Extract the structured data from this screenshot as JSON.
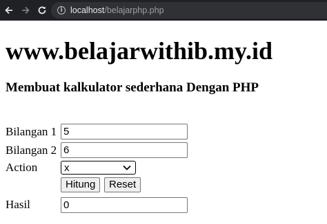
{
  "browser": {
    "url_host": "localhost",
    "url_path": "/belajarphp.php",
    "back_icon": "arrow-left-icon",
    "forward_icon": "arrow-right-icon",
    "reload_icon": "reload-icon",
    "info_icon": "info-icon"
  },
  "page": {
    "title": "www.belajarwithib.my.id",
    "subtitle": "Membuat kalkulator sederhana Dengan PHP"
  },
  "form": {
    "bilangan1_label": "Bilangan 1",
    "bilangan1_value": "5",
    "bilangan2_label": "Bilangan 2",
    "bilangan2_value": "6",
    "action_label": "Action",
    "action_selected": "x",
    "hitung_label": "Hitung",
    "reset_label": "Reset",
    "hasil_label": "Hasil",
    "hasil_value": "0"
  }
}
